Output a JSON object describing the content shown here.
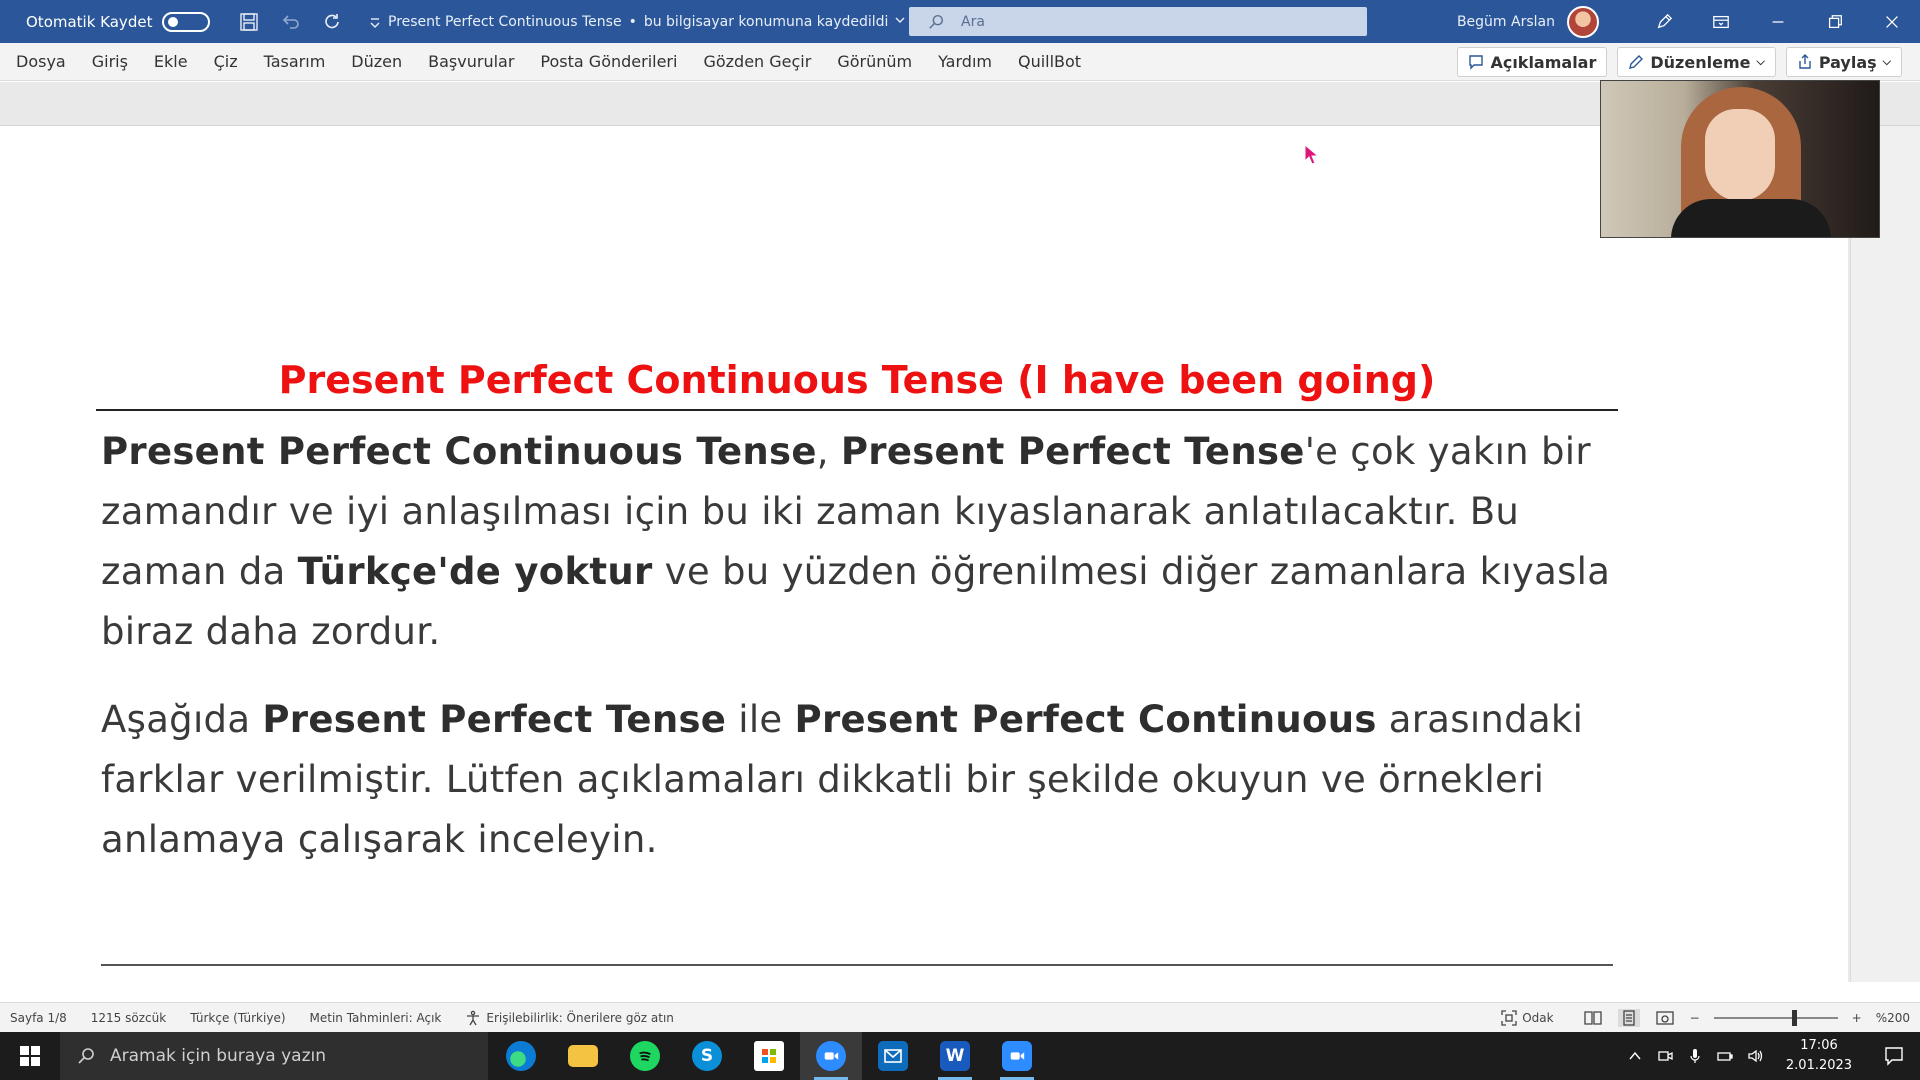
{
  "titlebar": {
    "autosave_label": "Otomatik Kaydet",
    "doc_name": "Present Perfect Continuous Tense",
    "separator": "•",
    "save_status": "bu bilgisayar konumuna kaydedildi",
    "search_placeholder": "Ara",
    "user_name": "Begüm Arslan",
    "accent_color": "#2b579a"
  },
  "menu": {
    "items": [
      "Dosya",
      "Giriş",
      "Ekle",
      "Çiz",
      "Tasarım",
      "Düzen",
      "Başvurular",
      "Posta Gönderileri",
      "Gözden Geçir",
      "Görünüm",
      "Yardım",
      "QuillBot"
    ],
    "comments_label": "Açıklamalar",
    "editing_label": "Düzenleme",
    "share_label": "Paylaş"
  },
  "document": {
    "heading": "Present Perfect Continuous Tense (I have been going)",
    "heading_color": "#ee1111",
    "p1": {
      "b1": "Present Perfect Continuous Tense",
      "t1": ", ",
      "b2": "Present Perfect Tense",
      "t2": "'e çok yakın bir zamandır ve iyi anlaşılması için bu iki zaman kıyaslanarak anlatılacaktır. Bu zaman da ",
      "b3": "Türkçe'de yoktur",
      "t3": " ve bu yüzden öğrenilmesi diğer zamanlara kıyasla biraz daha zordur."
    },
    "p2": {
      "t1": "Aşağıda ",
      "b1": "Present Perfect Tense",
      "t2": " ile ",
      "b2": "Present Perfect Continuous",
      "t3": " arasındaki farklar verilmiştir. Lütfen açıklamaları dikkatli bir şekilde okuyun ve örnekleri anlamaya çalışarak inceleyin."
    }
  },
  "statusbar": {
    "page": "Sayfa 1/8",
    "words": "1215 sözcük",
    "language": "Türkçe (Türkiye)",
    "predictions": "Metin Tahminleri: Açık",
    "accessibility": "Erişilebilirlik: Önerilere göz atın",
    "focus": "Odak",
    "zoom_minus": "−",
    "zoom_plus": "+",
    "zoom": "%200"
  },
  "taskbar": {
    "search_placeholder": "Aramak için buraya yazın",
    "time": "17:06",
    "date": "2.01.2023",
    "apps": [
      "edge-icon",
      "file-explorer-icon",
      "spotify-icon",
      "skype-icon",
      "store-icon",
      "zoom-icon",
      "mail-icon",
      "word-icon",
      "zoom-icon"
    ]
  }
}
